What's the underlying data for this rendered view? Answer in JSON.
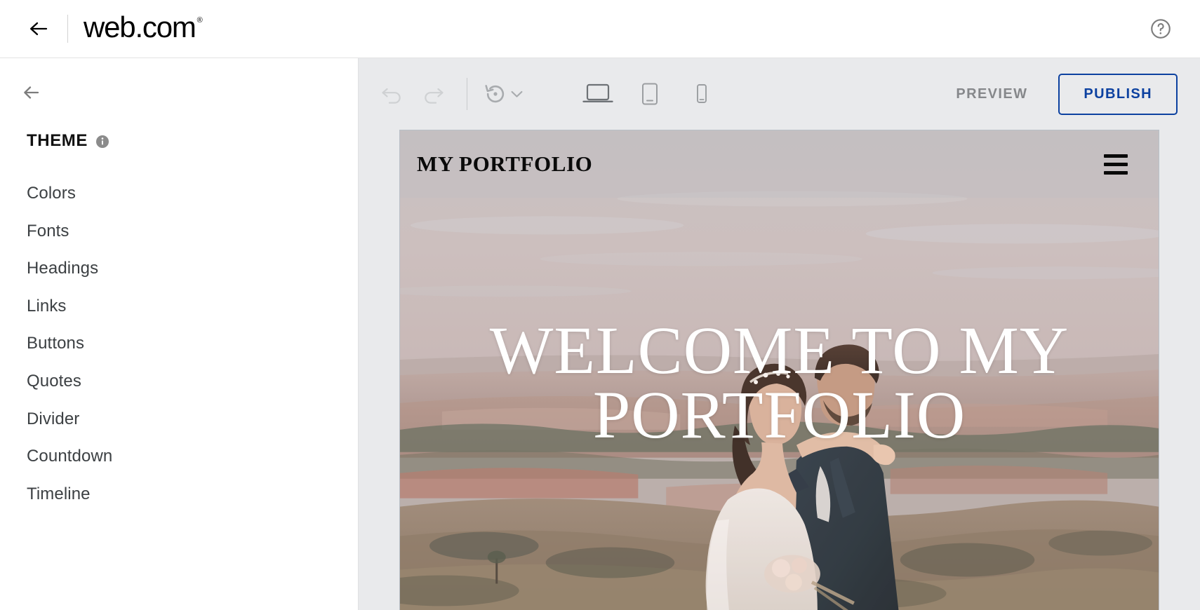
{
  "topbar": {
    "back_icon": "arrow-left-icon",
    "brand": "web.com",
    "brand_registered": "®",
    "help_icon": "help-circle-icon"
  },
  "sidebar": {
    "back_icon": "arrow-left-icon",
    "title": "THEME",
    "info_icon": "info-icon",
    "items": [
      {
        "label": "Colors"
      },
      {
        "label": "Fonts"
      },
      {
        "label": "Headings"
      },
      {
        "label": "Links"
      },
      {
        "label": "Buttons"
      },
      {
        "label": "Quotes"
      },
      {
        "label": "Divider"
      },
      {
        "label": "Countdown"
      },
      {
        "label": "Timeline"
      }
    ]
  },
  "toolbar": {
    "undo_icon": "undo-icon",
    "undo_enabled": "false",
    "redo_icon": "redo-icon",
    "redo_enabled": "false",
    "history_icon": "history-restore-icon",
    "history_chevron_icon": "chevron-down-icon",
    "devices": [
      {
        "name": "desktop",
        "icon": "laptop-icon",
        "active": "true"
      },
      {
        "name": "tablet",
        "icon": "tablet-icon",
        "active": "false"
      },
      {
        "name": "mobile",
        "icon": "mobile-icon",
        "active": "false"
      }
    ],
    "preview_label": "PREVIEW",
    "publish_label": "PUBLISH",
    "publish_color": "#0c41a0",
    "preview_color": "#86888b"
  },
  "canvas": {
    "site": {
      "brand": "MY PORTFOLIO",
      "menu_icon": "hamburger-menu-icon",
      "hero_title": "WELCOME TO MY PORTFOLIO",
      "hero_image_alt": "wedding-couple-on-hilltop-landscape"
    }
  },
  "colors": {
    "page_background": "#ffffff",
    "editor_background": "#e9eaec",
    "sidebar_background": "#ffffff",
    "accent_blue": "#0c41a0",
    "muted_text": "#86888b",
    "menu_text": "#3c4043"
  }
}
